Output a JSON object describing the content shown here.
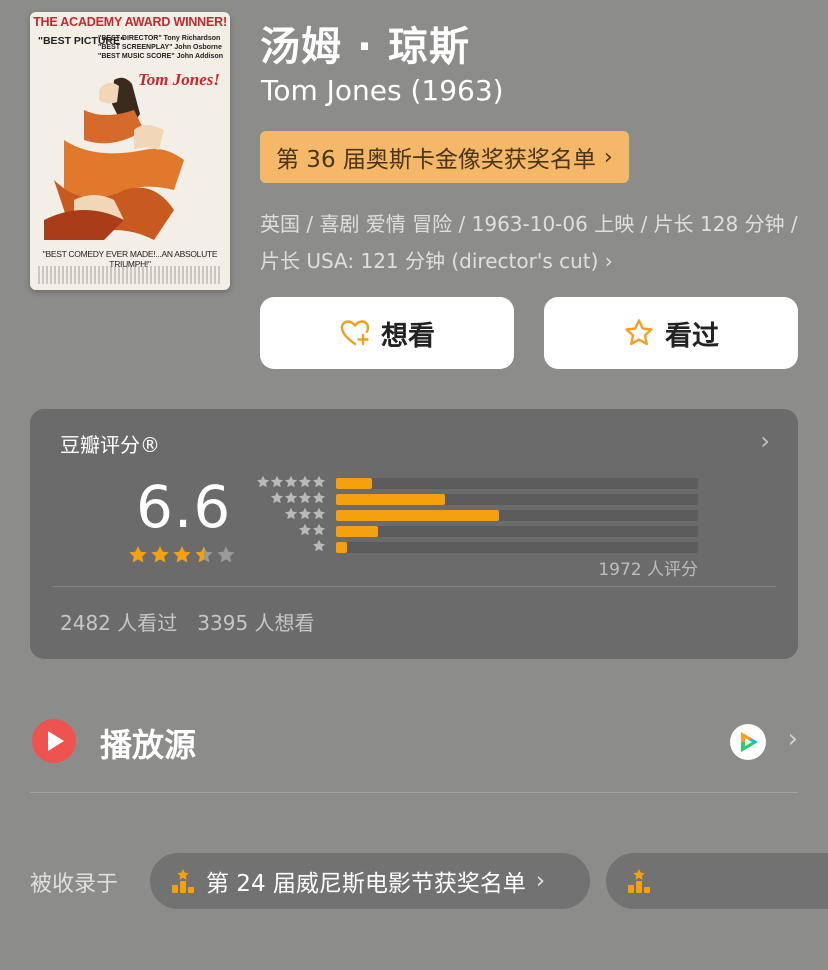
{
  "poster": {
    "top_banner": "THE ACADEMY AWARD WINNER!",
    "best_picture": "\"BEST PICTURE\"",
    "credits": [
      "\"BEST DIRECTOR\" Tony Richardson",
      "\"BEST SCREENPLAY\" John Osborne",
      "\"BEST MUSIC SCORE\" John Addison"
    ],
    "film_title": "Tom Jones!",
    "tagline": "\"BEST COMEDY EVER MADE!...AN ABSOLUTE TRIUMPH!\""
  },
  "title": {
    "cn": "汤姆 · 琼斯",
    "en": "Tom Jones (1963)"
  },
  "award": {
    "label": "第 36 届奥斯卡金像奖获奖名单"
  },
  "meta": {
    "text": "英国 / 喜剧 爱情 冒险 / 1963-10-06 上映 / 片长 128 分钟 / 片长 USA: 121 分钟 (director's cut)"
  },
  "actions": {
    "want": "想看",
    "seen": "看过"
  },
  "rating": {
    "label": "豆瓣评分®",
    "score": "6.6",
    "stars": 3.5,
    "count_text": "1972 人评分",
    "distribution": [
      {
        "stars": 5,
        "fraction": 0.1
      },
      {
        "stars": 4,
        "fraction": 0.3
      },
      {
        "stars": 3,
        "fraction": 0.45
      },
      {
        "stars": 2,
        "fraction": 0.115
      },
      {
        "stars": 1,
        "fraction": 0.03
      }
    ],
    "seen_text": "2482 人看过",
    "want_text": "3395 人想看"
  },
  "play": {
    "label": "播放源",
    "source_icon": "tencent-video-icon"
  },
  "collections": {
    "label": "被收录于",
    "items": [
      {
        "label": "第 24 届威尼斯电影节获奖名单"
      },
      {
        "label": ""
      }
    ]
  },
  "colors": {
    "background": "#8c8c8a",
    "award_pill": "#f4b868",
    "bar_fill": "#f5a00f",
    "star_fill": "#f5a00f",
    "play_icon": "#ef5350"
  }
}
